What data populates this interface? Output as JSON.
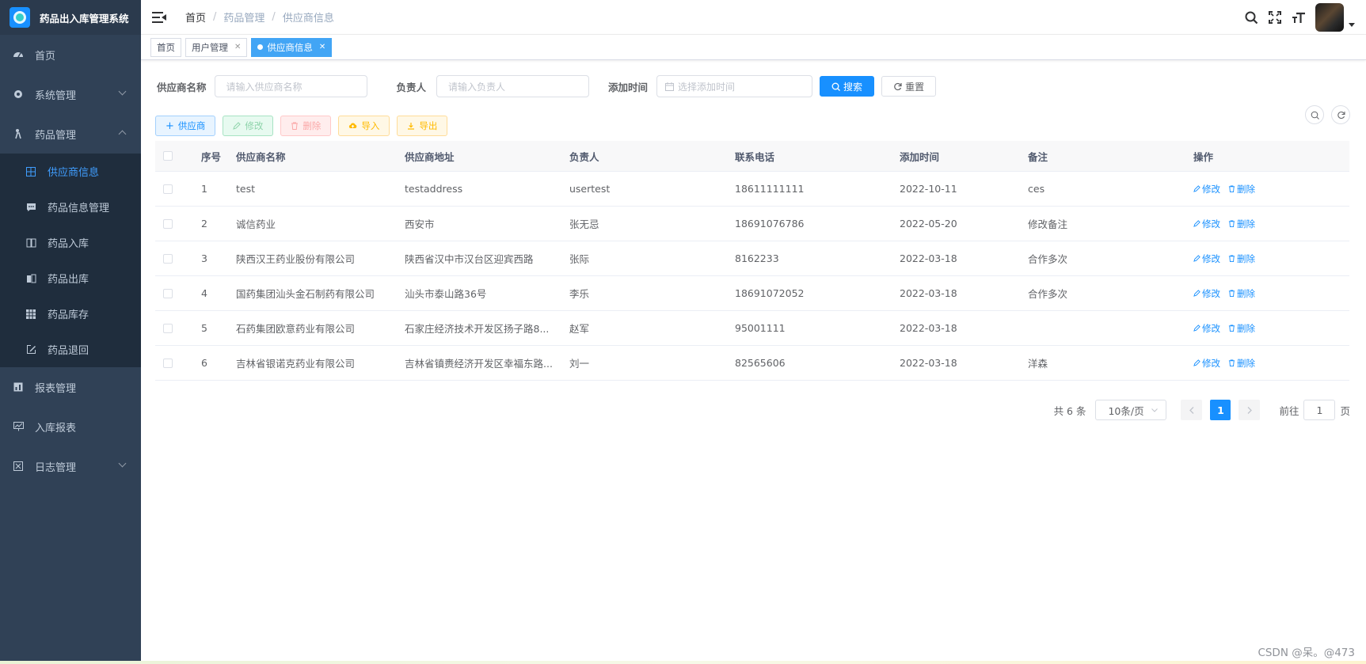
{
  "app": {
    "title": "药品出入库管理系统"
  },
  "sidebar": {
    "items": [
      {
        "label": "首页",
        "icon": "dashboard-icon"
      },
      {
        "label": "系统管理",
        "icon": "gear-icon"
      },
      {
        "label": "药品管理",
        "icon": "user-walk-icon"
      }
    ],
    "sub_items": [
      {
        "label": "供应商信息",
        "icon": "grid-icon",
        "active": true
      },
      {
        "label": "药品信息管理",
        "icon": "message-icon"
      },
      {
        "label": "药品入库",
        "icon": "book-icon"
      },
      {
        "label": "药品出库",
        "icon": "book-out-icon"
      },
      {
        "label": "药品库存",
        "icon": "table-icon"
      },
      {
        "label": "药品退回",
        "icon": "edit-icon"
      }
    ],
    "bottom_items": [
      {
        "label": "报表管理",
        "icon": "report-icon"
      },
      {
        "label": "入库报表",
        "icon": "monitor-chart-icon"
      },
      {
        "label": "日志管理",
        "icon": "log-icon"
      }
    ]
  },
  "breadcrumb": [
    "首页",
    "药品管理",
    "供应商信息"
  ],
  "tags": [
    {
      "label": "首页"
    },
    {
      "label": "用户管理"
    },
    {
      "label": "供应商信息",
      "active": true
    }
  ],
  "search": {
    "supplier_label": "供应商名称",
    "supplier_placeholder": "请输入供应商名称",
    "person_label": "负责人",
    "person_placeholder": "请输入负责人",
    "time_label": "添加时间",
    "time_placeholder": "选择添加时间",
    "search_btn": "搜索",
    "reset_btn": "重置"
  },
  "toolbar": {
    "add": "供应商",
    "edit": "修改",
    "delete": "删除",
    "import": "导入",
    "export": "导出"
  },
  "table": {
    "headers": [
      "序号",
      "供应商名称",
      "供应商地址",
      "负责人",
      "联系电话",
      "添加时间",
      "备注",
      "操作"
    ],
    "rows": [
      {
        "no": "1",
        "name": "test",
        "address": "testaddress",
        "person": "usertest",
        "phone": "18611111111",
        "time": "2022-10-11",
        "remark": "ces"
      },
      {
        "no": "2",
        "name": "诚信药业",
        "address": "西安市",
        "person": "张无忌",
        "phone": "18691076786",
        "time": "2022-05-20",
        "remark": "修改备注"
      },
      {
        "no": "3",
        "name": "陕西汉王药业股份有限公司",
        "address": "陕西省汉中市汉台区迎宾西路",
        "person": "张际",
        "phone": "8162233",
        "time": "2022-03-18",
        "remark": "合作多次"
      },
      {
        "no": "4",
        "name": "国药集团汕头金石制药有限公司",
        "address": "汕头市泰山路36号",
        "person": "李乐",
        "phone": "18691072052",
        "time": "2022-03-18",
        "remark": "合作多次"
      },
      {
        "no": "5",
        "name": "石药集团欧意药业有限公司",
        "address": "石家庄经济技术开发区扬子路8...",
        "person": "赵军",
        "phone": "95001111",
        "time": "2022-03-18",
        "remark": ""
      },
      {
        "no": "6",
        "name": "吉林省银诺克药业有限公司",
        "address": "吉林省镇赉经济开发区幸福东路...",
        "person": "刘一",
        "phone": "82565606",
        "time": "2022-03-18",
        "remark": "洋森"
      }
    ],
    "op_edit": "修改",
    "op_delete": "删除"
  },
  "pagination": {
    "total": "共 6 条",
    "page_size": "10条/页",
    "current_page": "1",
    "goto_prefix": "前往",
    "goto_value": "1",
    "goto_suffix": "页"
  },
  "watermark": "CSDN @呆。@473",
  "colors": {
    "primary": "#1890ff",
    "sidebar_bg": "#304156",
    "submenu_bg": "#1f2d3d",
    "active_menu": "#409eff"
  }
}
